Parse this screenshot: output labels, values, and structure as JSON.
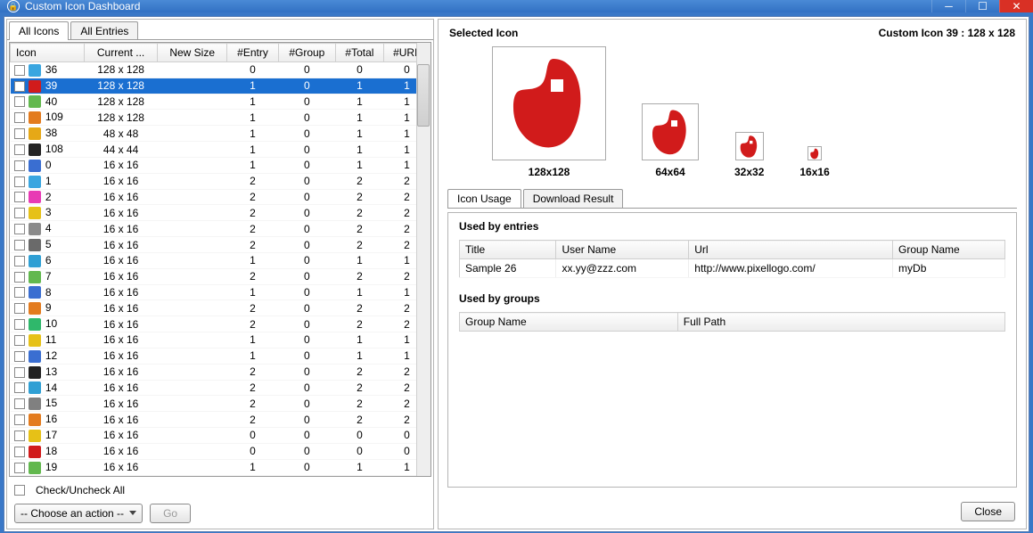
{
  "window": {
    "title": "Custom Icon Dashboard"
  },
  "leftTabs": [
    "All Icons",
    "All Entries"
  ],
  "leftTabActive": 0,
  "columns": [
    "Icon",
    "Current ...",
    "New Size",
    "#Entry",
    "#Group",
    "#Total",
    "#URL"
  ],
  "rows": [
    {
      "id": "36",
      "c": "#3aa6e0",
      "size": "128 x 128",
      "ns": "",
      "e": 0,
      "g": 0,
      "t": 0,
      "u": 0
    },
    {
      "id": "39",
      "c": "#d11b1b",
      "size": "128 x 128",
      "ns": "",
      "e": 1,
      "g": 0,
      "t": 1,
      "u": 1,
      "sel": true
    },
    {
      "id": "40",
      "c": "#62b84e",
      "size": "128 x 128",
      "ns": "",
      "e": 1,
      "g": 0,
      "t": 1,
      "u": 1
    },
    {
      "id": "109",
      "c": "#e37b1e",
      "size": "128 x 128",
      "ns": "",
      "e": 1,
      "g": 0,
      "t": 1,
      "u": 1
    },
    {
      "id": "38",
      "c": "#e6a817",
      "size": "48 x 48",
      "ns": "",
      "e": 1,
      "g": 0,
      "t": 1,
      "u": 1
    },
    {
      "id": "108",
      "c": "#222222",
      "size": "44 x 44",
      "ns": "",
      "e": 1,
      "g": 0,
      "t": 1,
      "u": 1
    },
    {
      "id": "0",
      "c": "#3a6ed1",
      "size": "16 x 16",
      "ns": "",
      "e": 1,
      "g": 0,
      "t": 1,
      "u": 1
    },
    {
      "id": "1",
      "c": "#3aa6e0",
      "size": "16 x 16",
      "ns": "",
      "e": 2,
      "g": 0,
      "t": 2,
      "u": 2
    },
    {
      "id": "2",
      "c": "#e83ab4",
      "size": "16 x 16",
      "ns": "",
      "e": 2,
      "g": 0,
      "t": 2,
      "u": 2
    },
    {
      "id": "3",
      "c": "#e6c117",
      "size": "16 x 16",
      "ns": "",
      "e": 2,
      "g": 0,
      "t": 2,
      "u": 2
    },
    {
      "id": "4",
      "c": "#8a8a8a",
      "size": "16 x 16",
      "ns": "",
      "e": 2,
      "g": 0,
      "t": 2,
      "u": 2
    },
    {
      "id": "5",
      "c": "#6a6a6a",
      "size": "16 x 16",
      "ns": "",
      "e": 2,
      "g": 0,
      "t": 2,
      "u": 2
    },
    {
      "id": "6",
      "c": "#2f9fd4",
      "size": "16 x 16",
      "ns": "",
      "e": 1,
      "g": 0,
      "t": 1,
      "u": 1
    },
    {
      "id": "7",
      "c": "#62b84e",
      "size": "16 x 16",
      "ns": "",
      "e": 2,
      "g": 0,
      "t": 2,
      "u": 2
    },
    {
      "id": "8",
      "c": "#3a6ed1",
      "size": "16 x 16",
      "ns": "",
      "e": 1,
      "g": 0,
      "t": 1,
      "u": 1
    },
    {
      "id": "9",
      "c": "#e37b1e",
      "size": "16 x 16",
      "ns": "",
      "e": 2,
      "g": 0,
      "t": 2,
      "u": 2
    },
    {
      "id": "10",
      "c": "#2fb86b",
      "size": "16 x 16",
      "ns": "",
      "e": 2,
      "g": 0,
      "t": 2,
      "u": 2
    },
    {
      "id": "11",
      "c": "#e6c117",
      "size": "16 x 16",
      "ns": "",
      "e": 1,
      "g": 0,
      "t": 1,
      "u": 1
    },
    {
      "id": "12",
      "c": "#3a6ed1",
      "size": "16 x 16",
      "ns": "",
      "e": 1,
      "g": 0,
      "t": 1,
      "u": 1
    },
    {
      "id": "13",
      "c": "#222222",
      "size": "16 x 16",
      "ns": "",
      "e": 2,
      "g": 0,
      "t": 2,
      "u": 2
    },
    {
      "id": "14",
      "c": "#2f9fd4",
      "size": "16 x 16",
      "ns": "",
      "e": 2,
      "g": 0,
      "t": 2,
      "u": 2
    },
    {
      "id": "15",
      "c": "#808080",
      "size": "16 x 16",
      "ns": "",
      "e": 2,
      "g": 0,
      "t": 2,
      "u": 2
    },
    {
      "id": "16",
      "c": "#e37b1e",
      "size": "16 x 16",
      "ns": "",
      "e": 2,
      "g": 0,
      "t": 2,
      "u": 2
    },
    {
      "id": "17",
      "c": "#e6c117",
      "size": "16 x 16",
      "ns": "",
      "e": 0,
      "g": 0,
      "t": 0,
      "u": 0
    },
    {
      "id": "18",
      "c": "#d11b1b",
      "size": "16 x 16",
      "ns": "",
      "e": 0,
      "g": 0,
      "t": 0,
      "u": 0
    },
    {
      "id": "19",
      "c": "#62b84e",
      "size": "16 x 16",
      "ns": "",
      "e": 1,
      "g": 0,
      "t": 1,
      "u": 1
    }
  ],
  "checkAll": "Check/Uncheck All",
  "actionCombo": "-- Choose an action --",
  "goBtn": "Go",
  "right": {
    "selectedLabel": "Selected Icon",
    "headerRight": "Custom Icon 39 : 128 x 128",
    "sizes": [
      "128x128",
      "64x64",
      "32x32",
      "16x16"
    ],
    "tabs": [
      "Icon Usage",
      "Download Result"
    ],
    "tabActive": 0,
    "usedByEntries": "Used by entries",
    "usedByGroups": "Used by groups",
    "entryCols": [
      "Title",
      "User Name",
      "Url",
      "Group Name"
    ],
    "entryRow": {
      "title": "Sample 26",
      "user": "xx.yy@zzz.com",
      "url": "http://www.pixellogo.com/",
      "group": "myDb"
    },
    "groupCols": [
      "Group Name",
      "Full Path"
    ],
    "closeBtn": "Close"
  }
}
